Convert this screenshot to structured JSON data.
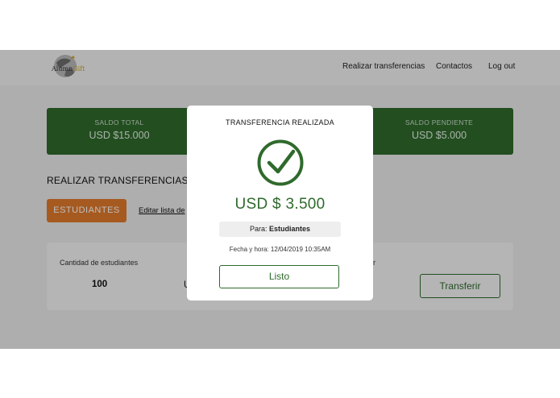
{
  "header": {
    "logo_text_main": "Alumn",
    "logo_text_accent": "Gift",
    "nav": [
      "Realizar transferencias",
      "Contactos",
      "Log out"
    ]
  },
  "balances": [
    {
      "label": "SALDO TOTAL",
      "value": "USD $15.000"
    },
    {
      "label": "SALDO PENDIENTE",
      "value": "USD $5.000"
    }
  ],
  "section_title": "REALIZAR TRANSFERENCIAS",
  "tab_label": "ESTUDIANTES",
  "edit_link": "Editar lista de",
  "card": {
    "students_label": "Cantidad de estudiantes",
    "students_value": "100",
    "partial_value": "U",
    "partial_label": "rir",
    "transfer_button": "Transferir"
  },
  "modal": {
    "title": "TRANSFERENCIA REALIZADA",
    "amount": "USD $ 3.500",
    "to_label": "Para:",
    "to_value": "Estudiantes",
    "datetime": "Fecha y hora: 12/04/2019 10:35AM",
    "done_button": "Listo"
  },
  "colors": {
    "primary_green": "#2f6a2c",
    "accent_orange": "#e07a2c",
    "overlay": "rgba(0,0,0,0.26)"
  },
  "icons": {
    "logo": "globe-logo-icon",
    "success": "check-circle-icon"
  }
}
